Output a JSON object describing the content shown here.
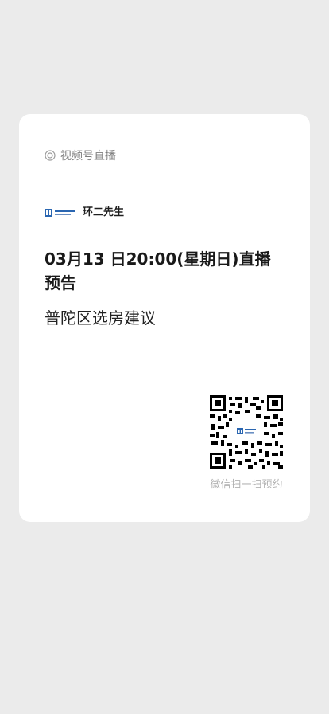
{
  "card": {
    "channel_label": "视频号直播",
    "account_name": "环二先生",
    "title": "03月13 日20:00(星期日)直播预告",
    "subtitle": "普陀区选房建议",
    "qr_caption": "微信扫一扫预约"
  },
  "icons": {
    "channel": "channels-ring-icon",
    "brand": "brand-logo",
    "qr": "qr-code"
  },
  "colors": {
    "background": "#ebebeb",
    "card": "#ffffff",
    "accent_blue": "#2a66b1"
  }
}
